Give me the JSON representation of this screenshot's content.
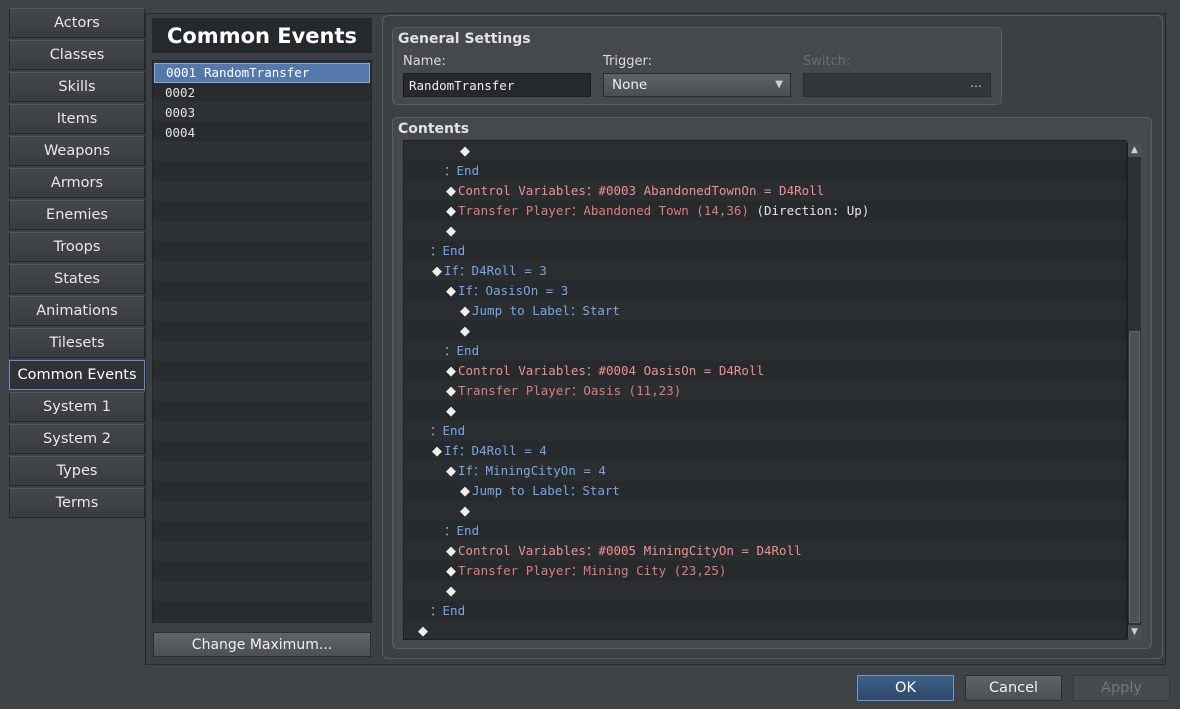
{
  "tabs": [
    "Actors",
    "Classes",
    "Skills",
    "Items",
    "Weapons",
    "Armors",
    "Enemies",
    "Troops",
    "States",
    "Animations",
    "Tilesets",
    "Common Events",
    "System 1",
    "System 2",
    "Types",
    "Terms"
  ],
  "active_tab": "Common Events",
  "common_events": {
    "title": "Common Events",
    "items": [
      {
        "id": "0001",
        "name": "RandomTransfer",
        "selected": true
      },
      {
        "id": "0002",
        "name": ""
      },
      {
        "id": "0003",
        "name": ""
      },
      {
        "id": "0004",
        "name": ""
      }
    ],
    "change_max_label": "Change Maximum..."
  },
  "general": {
    "title": "General Settings",
    "name_label": "Name:",
    "name_value": "RandomTransfer",
    "trigger_label": "Trigger:",
    "trigger_value": "None",
    "switch_label": "Switch:",
    "switch_button": "…"
  },
  "contents": {
    "title": "Contents",
    "rows": [
      {
        "indent": 3,
        "parts": [
          [
            "d",
            ""
          ]
        ]
      },
      {
        "indent": 2,
        "parts": [
          [
            "colon",
            "："
          ],
          [
            "blue",
            "End"
          ]
        ]
      },
      {
        "indent": 2,
        "parts": [
          [
            "d",
            ""
          ],
          [
            "red",
            "Control Variables：#0003 AbandonedTownOn = D4Roll"
          ]
        ]
      },
      {
        "indent": 2,
        "parts": [
          [
            "d",
            ""
          ],
          [
            "tp",
            "Transfer Player：Abandoned Town (14,36)"
          ],
          [
            "white",
            " (Direction: Up)"
          ]
        ]
      },
      {
        "indent": 2,
        "parts": [
          [
            "d",
            ""
          ]
        ]
      },
      {
        "indent": 1,
        "parts": [
          [
            "colon",
            "："
          ],
          [
            "blue",
            "End"
          ]
        ]
      },
      {
        "indent": 1,
        "parts": [
          [
            "d",
            ""
          ],
          [
            "blue",
            "If：D4Roll = 3"
          ]
        ]
      },
      {
        "indent": 2,
        "parts": [
          [
            "d",
            ""
          ],
          [
            "blue",
            "If：OasisOn = 3"
          ]
        ]
      },
      {
        "indent": 3,
        "parts": [
          [
            "d",
            ""
          ],
          [
            "blue",
            "Jump to Label：Start"
          ]
        ]
      },
      {
        "indent": 3,
        "parts": [
          [
            "d",
            ""
          ]
        ]
      },
      {
        "indent": 2,
        "parts": [
          [
            "colon",
            "："
          ],
          [
            "blue",
            "End"
          ]
        ]
      },
      {
        "indent": 2,
        "parts": [
          [
            "d",
            ""
          ],
          [
            "red",
            "Control Variables：#0004 OasisOn = D4Roll"
          ]
        ]
      },
      {
        "indent": 2,
        "parts": [
          [
            "d",
            ""
          ],
          [
            "tp",
            "Transfer Player：Oasis (11,23)"
          ]
        ]
      },
      {
        "indent": 2,
        "parts": [
          [
            "d",
            ""
          ]
        ]
      },
      {
        "indent": 1,
        "parts": [
          [
            "colon",
            "："
          ],
          [
            "blue",
            "End"
          ]
        ]
      },
      {
        "indent": 1,
        "parts": [
          [
            "d",
            ""
          ],
          [
            "blue",
            "If：D4Roll = 4"
          ]
        ]
      },
      {
        "indent": 2,
        "parts": [
          [
            "d",
            ""
          ],
          [
            "blue",
            "If：MiningCityOn = 4"
          ]
        ]
      },
      {
        "indent": 3,
        "parts": [
          [
            "d",
            ""
          ],
          [
            "blue",
            "Jump to Label：Start"
          ]
        ]
      },
      {
        "indent": 3,
        "parts": [
          [
            "d",
            ""
          ]
        ]
      },
      {
        "indent": 2,
        "parts": [
          [
            "colon",
            "："
          ],
          [
            "blue",
            "End"
          ]
        ]
      },
      {
        "indent": 2,
        "parts": [
          [
            "d",
            ""
          ],
          [
            "red",
            "Control Variables：#0005 MiningCityOn = D4Roll"
          ]
        ]
      },
      {
        "indent": 2,
        "parts": [
          [
            "d",
            ""
          ],
          [
            "tp",
            "Transfer Player：Mining City (23,25)"
          ]
        ]
      },
      {
        "indent": 2,
        "parts": [
          [
            "d",
            ""
          ]
        ]
      },
      {
        "indent": 1,
        "parts": [
          [
            "colon",
            "："
          ],
          [
            "blue",
            "End"
          ]
        ]
      },
      {
        "indent": 0,
        "parts": [
          [
            "d",
            ""
          ]
        ]
      }
    ]
  },
  "buttons": {
    "ok": "OK",
    "cancel": "Cancel",
    "apply": "Apply"
  },
  "icons": {
    "diamond": "◆",
    "dropdown_arrow": "▼",
    "scroll_up": "▲",
    "scroll_down": "▼"
  },
  "colors": {
    "accent": "#5478ad",
    "keyword_blue": "#74a7e8",
    "variable_red": "#ef8f8f"
  }
}
